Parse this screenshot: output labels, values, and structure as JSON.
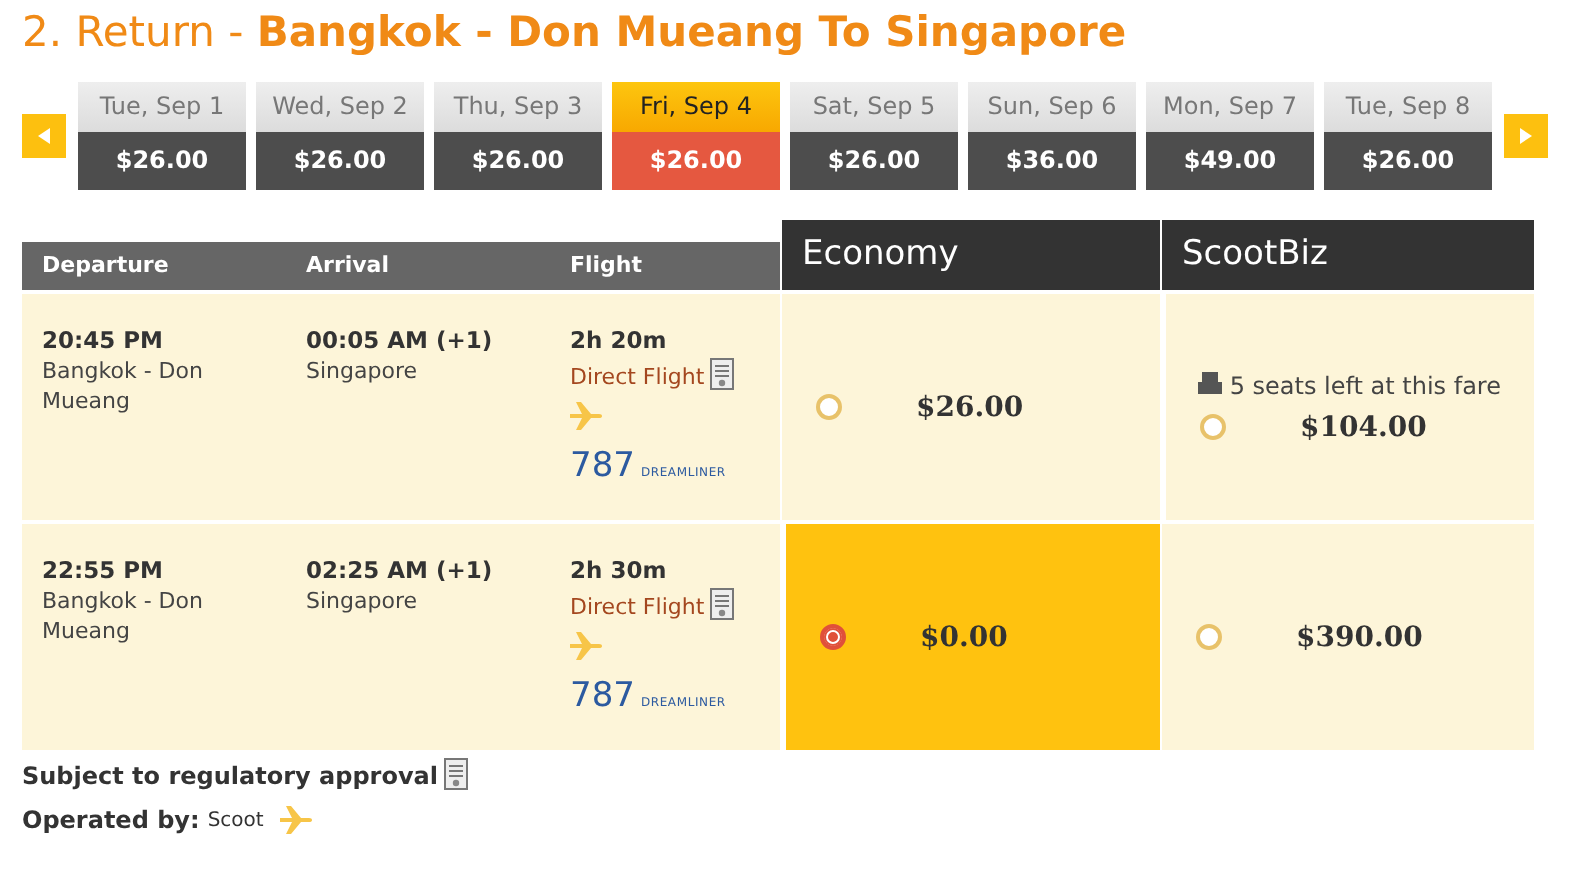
{
  "title": {
    "prefix": "2. Return - ",
    "route": "Bangkok - Don Mueang To Singapore"
  },
  "dates": [
    {
      "label": "Tue, Sep 1",
      "price": "$26.00",
      "selected": false
    },
    {
      "label": "Wed, Sep 2",
      "price": "$26.00",
      "selected": false
    },
    {
      "label": "Thu, Sep 3",
      "price": "$26.00",
      "selected": false
    },
    {
      "label": "Fri, Sep 4",
      "price": "$26.00",
      "selected": true
    },
    {
      "label": "Sat, Sep 5",
      "price": "$26.00",
      "selected": false
    },
    {
      "label": "Sun, Sep 6",
      "price": "$36.00",
      "selected": false
    },
    {
      "label": "Mon, Sep 7",
      "price": "$49.00",
      "selected": false
    },
    {
      "label": "Tue, Sep 8",
      "price": "$26.00",
      "selected": false
    }
  ],
  "table": {
    "columns": [
      "Departure",
      "Arrival",
      "Flight"
    ],
    "fare_columns": [
      "Economy",
      "ScootBiz"
    ],
    "rows": [
      {
        "departure_time": "20:45 PM",
        "departure_place": "Bangkok - Don Mueang",
        "arrival_time": "00:05 AM (+1)",
        "arrival_place": "Singapore",
        "duration": "2h 20m",
        "flight_type": "Direct Flight",
        "aircraft": "787",
        "aircraft_name": "DREAMLINER",
        "fares": [
          {
            "price": "$26.00",
            "selected": false
          },
          {
            "note": "5 seats left at this fare",
            "price": "$104.00",
            "selected": false
          }
        ]
      },
      {
        "departure_time": "22:55 PM",
        "departure_place": "Bangkok - Don Mueang",
        "arrival_time": "02:25 AM (+1)",
        "arrival_place": "Singapore",
        "duration": "2h 30m",
        "flight_type": "Direct Flight",
        "aircraft": "787",
        "aircraft_name": "DREAMLINER",
        "fares": [
          {
            "price": "$0.00",
            "selected": true
          },
          {
            "price": "$390.00",
            "selected": false
          }
        ]
      }
    ]
  },
  "notes": {
    "approval": "Subject to regulatory approval",
    "operated_label": "Operated by:",
    "operator": "Scoot"
  }
}
